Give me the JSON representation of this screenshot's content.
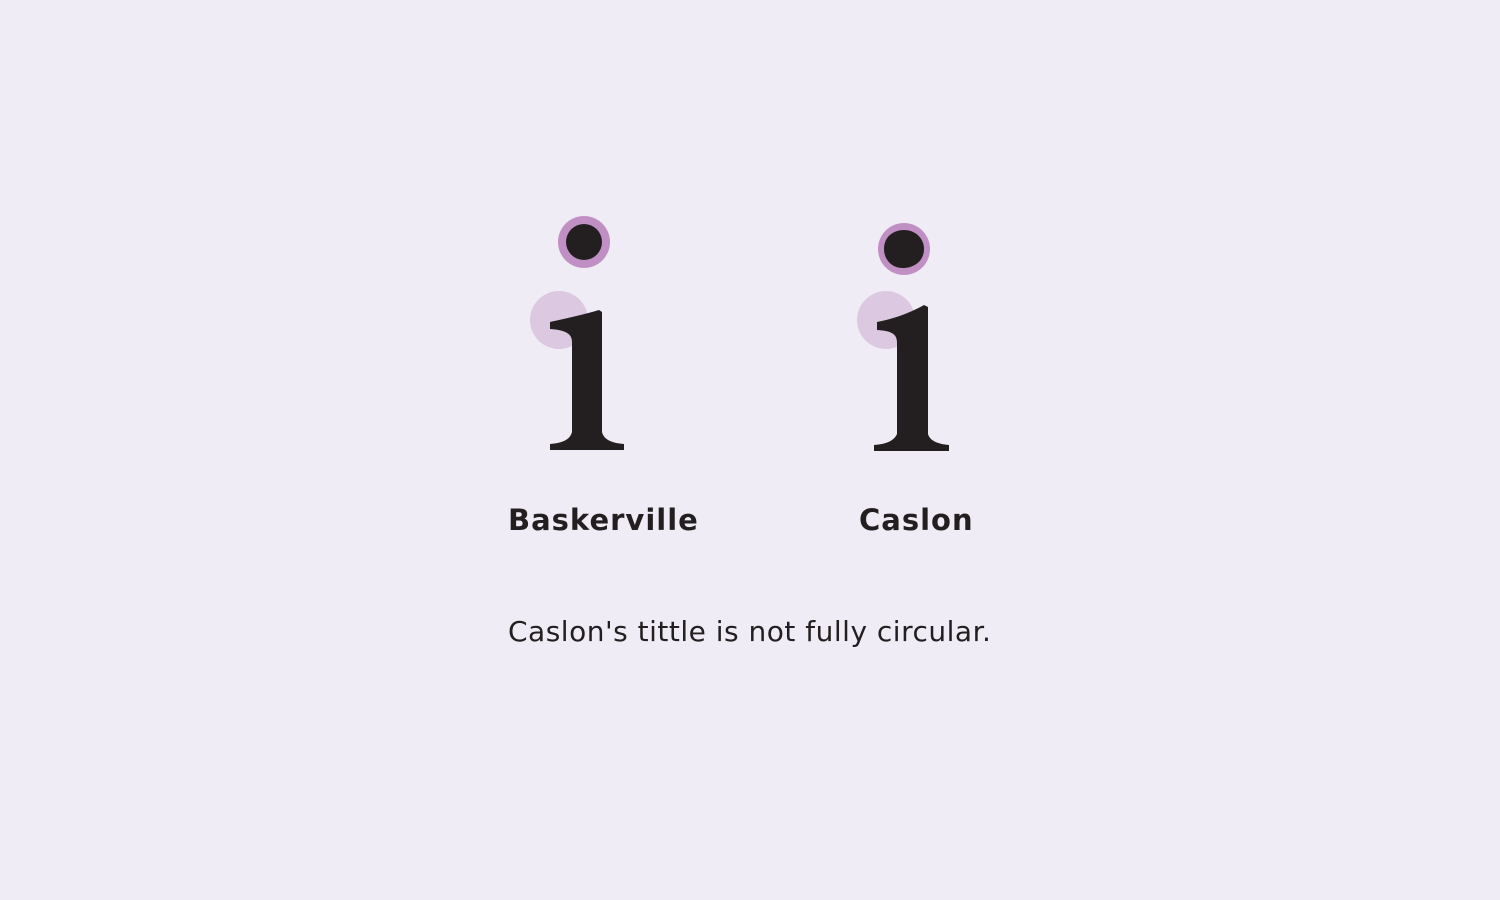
{
  "figure": {
    "background_color": "#efecf5",
    "ink_color": "#231f20",
    "tittle_ring_color": "#c08fc3",
    "highlight_color": "#dcc8e0"
  },
  "glyphs": [
    {
      "character": "i",
      "font": "Baskerville",
      "tittle_shape": "circular"
    },
    {
      "character": "i",
      "font": "Caslon",
      "tittle_shape": "not fully circular"
    }
  ],
  "labels": {
    "baskerville": "Baskerville",
    "caslon": "Caslon"
  },
  "caption": "Caslon's tittle is not fully circular."
}
